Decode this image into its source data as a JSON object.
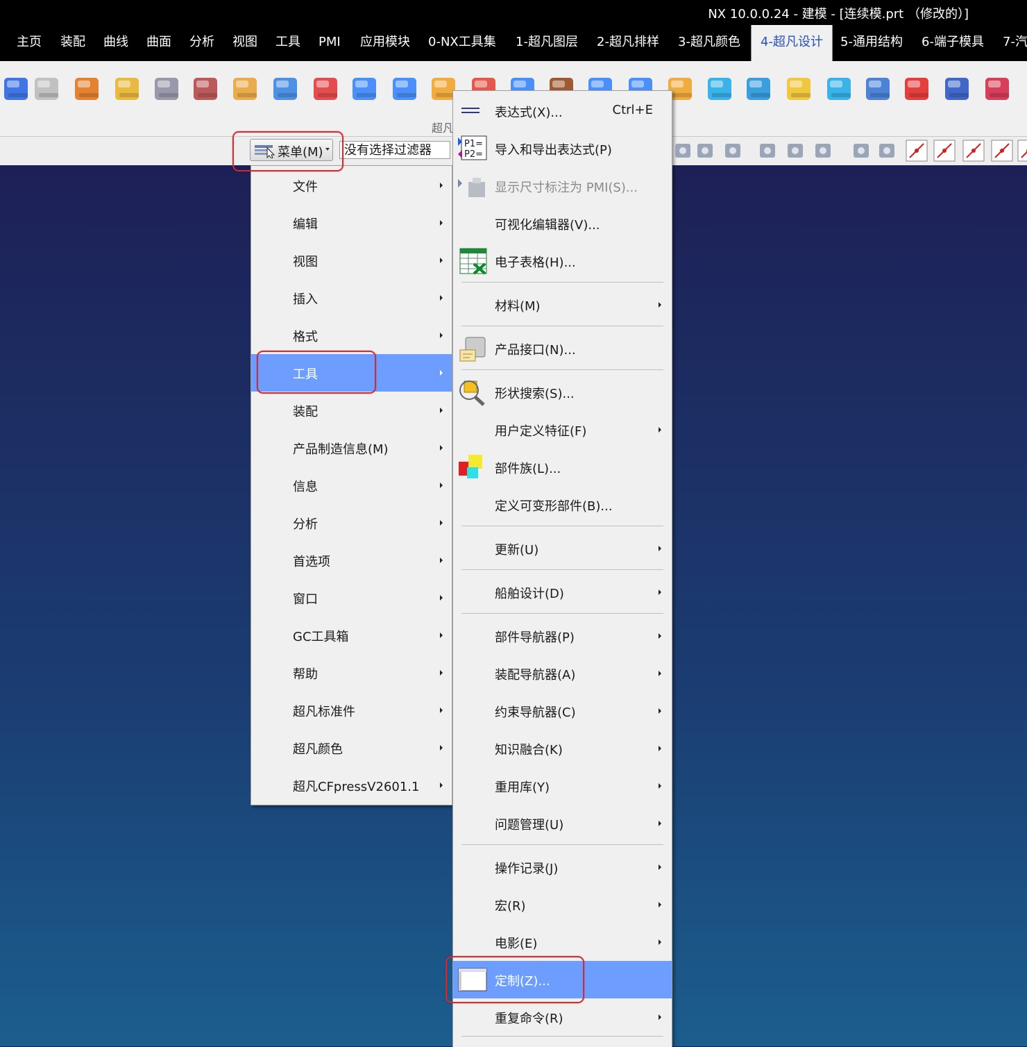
{
  "window": {
    "title": "NX 10.0.0.24 - 建模 - [连续模.prt （修改的）]"
  },
  "tabs": [
    "主页",
    "装配",
    "曲线",
    "曲面",
    "分析",
    "视图",
    "工具",
    "PMI",
    "应用模块",
    "0-NX工具集",
    "1-超凡图层",
    "2-超凡排样",
    "3-超凡颜色",
    "4-超凡设计",
    "5-通用结构",
    "6-端子模具",
    "7-汽"
  ],
  "active_tab": "4-超凡设计",
  "ribbon": {
    "group_label": "超凡"
  },
  "selection_bar": {
    "menu_label": "菜单(M)",
    "filter_value": "没有选择过滤器"
  },
  "main_menu": {
    "items": [
      "文件",
      "编辑",
      "视图",
      "插入",
      "格式",
      "工具",
      "装配",
      "产品制造信息(M)",
      "信息",
      "分析",
      "首选项",
      "窗口",
      "GC工具箱",
      "帮助",
      "超凡标准件",
      "超凡颜色",
      "超凡CFpressV2601.1"
    ],
    "highlighted": "工具"
  },
  "tools_menu": {
    "items": [
      {
        "label": "表达式(X)...",
        "shortcut": "Ctrl+E",
        "icon": "expression-icon"
      },
      {
        "label": "导入和导出表达式(P)",
        "icon": "import-export-expression-icon"
      },
      {
        "label": "显示尺寸标注为 PMI(S)...",
        "icon": "pmi-dimension-icon",
        "disabled": true
      },
      {
        "label": "可视化编辑器(V)..."
      },
      {
        "label": "电子表格(H)...",
        "icon": "spreadsheet-icon"
      },
      {
        "label": "材料(M)",
        "submenu": true
      },
      {
        "label": "产品接口(N)...",
        "icon": "product-interface-icon"
      },
      {
        "label": "形状搜索(S)...",
        "icon": "shape-search-icon"
      },
      {
        "label": "用户定义特征(F)",
        "submenu": true
      },
      {
        "label": "部件族(L)...",
        "icon": "part-family-icon"
      },
      {
        "label": "定义可变形部件(B)..."
      },
      {
        "label": "更新(U)",
        "submenu": true
      },
      {
        "label": "船舶设计(D)",
        "submenu": true
      },
      {
        "label": "部件导航器(P)",
        "submenu": true
      },
      {
        "label": "装配导航器(A)",
        "submenu": true
      },
      {
        "label": "约束导航器(C)",
        "submenu": true
      },
      {
        "label": "知识融合(K)",
        "submenu": true
      },
      {
        "label": "重用库(Y)",
        "submenu": true
      },
      {
        "label": "问题管理(U)",
        "submenu": true
      },
      {
        "label": "操作记录(J)",
        "submenu": true
      },
      {
        "label": "宏(R)",
        "submenu": true
      },
      {
        "label": "电影(E)",
        "submenu": true
      },
      {
        "label": "定制(Z)...",
        "icon": "customize-window-icon",
        "highlighted": true
      },
      {
        "label": "重复命令(R)",
        "submenu": true
      }
    ]
  },
  "colors": {
    "highlight": "#6d9eff",
    "annotation": "#e0252b"
  }
}
